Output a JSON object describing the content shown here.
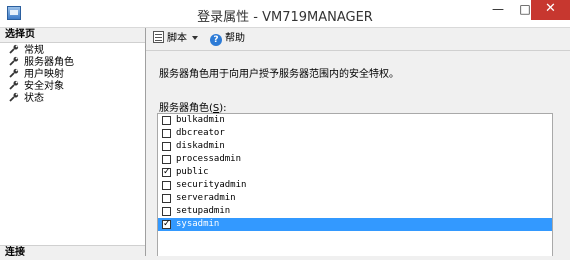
{
  "window": {
    "title": "登录属性 - VM719MANAGER",
    "minimize_glyph": "—",
    "maximize_glyph": "□",
    "close_glyph": "✕"
  },
  "left_pane": {
    "header": "选择页",
    "items": [
      {
        "label": "常规",
        "icon": "wrench-icon"
      },
      {
        "label": "服务器角色",
        "icon": "wrench-icon"
      },
      {
        "label": "用户映射",
        "icon": "wrench-icon"
      },
      {
        "label": "安全对象",
        "icon": "wrench-icon"
      },
      {
        "label": "状态",
        "icon": "wrench-icon"
      }
    ],
    "footer": "连接"
  },
  "toolbar": {
    "script_label": "脚本",
    "help_label": "帮助",
    "help_glyph": "?"
  },
  "content": {
    "description": "服务器角色用于向用户授予服务器范围内的安全特权。",
    "roles_label_prefix": "服务器角色(",
    "roles_label_mnemonic": "S",
    "roles_label_suffix": "):",
    "roles": [
      {
        "name": "bulkadmin",
        "checked": false,
        "mark": ""
      },
      {
        "name": "dbcreator",
        "checked": false,
        "mark": ""
      },
      {
        "name": "diskadmin",
        "checked": false,
        "mark": ""
      },
      {
        "name": "processadmin",
        "checked": false,
        "mark": ""
      },
      {
        "name": "public",
        "checked": true,
        "mark": "✓"
      },
      {
        "name": "securityadmin",
        "checked": false,
        "mark": ""
      },
      {
        "name": "serveradmin",
        "checked": false,
        "mark": ""
      },
      {
        "name": "setupadmin",
        "checked": false,
        "mark": ""
      },
      {
        "name": "sysadmin",
        "checked": true,
        "mark": "✓",
        "selected": true
      }
    ]
  },
  "colors": {
    "selection": "#3399ff",
    "close_button": "#c7372f",
    "help_icon": "#2d7bd6"
  }
}
